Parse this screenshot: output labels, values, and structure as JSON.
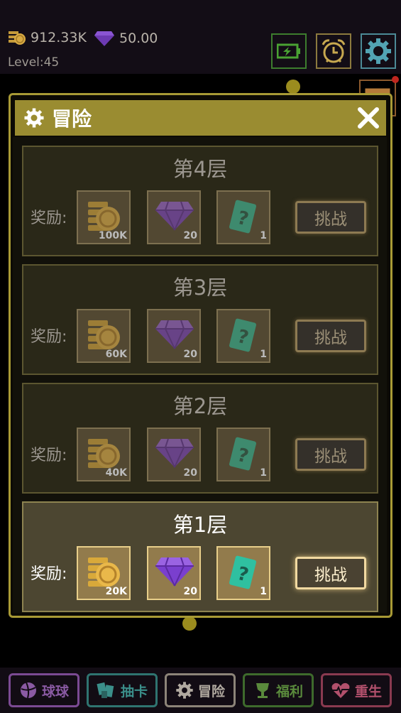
{
  "resources": {
    "coins": "912.33K",
    "gems": "50.00",
    "level": "Level:45"
  },
  "top_buttons": [
    "battery-icon",
    "alarm-clock-icon",
    "gear-icon"
  ],
  "dialog": {
    "title": "冒险",
    "floors": [
      {
        "title": "第4层",
        "reward_label": "奖励:",
        "rewards": {
          "coins": "100K",
          "gems": "20",
          "cards": "1"
        },
        "button": "挑战",
        "active": false
      },
      {
        "title": "第3层",
        "reward_label": "奖励:",
        "rewards": {
          "coins": "60K",
          "gems": "20",
          "cards": "1"
        },
        "button": "挑战",
        "active": false
      },
      {
        "title": "第2层",
        "reward_label": "奖励:",
        "rewards": {
          "coins": "40K",
          "gems": "20",
          "cards": "1"
        },
        "button": "挑战",
        "active": false
      },
      {
        "title": "第1层",
        "reward_label": "奖励:",
        "rewards": {
          "coins": "20K",
          "gems": "20",
          "cards": "1"
        },
        "button": "挑战",
        "active": true
      }
    ]
  },
  "nav": [
    {
      "label": "球球",
      "color": "#7b4a93"
    },
    {
      "label": "抽卡",
      "color": "#2f7470"
    },
    {
      "label": "冒险",
      "color": "#8c8478"
    },
    {
      "label": "福利",
      "color": "#3e6a2c"
    },
    {
      "label": "重生",
      "color": "#8a3a50"
    }
  ]
}
